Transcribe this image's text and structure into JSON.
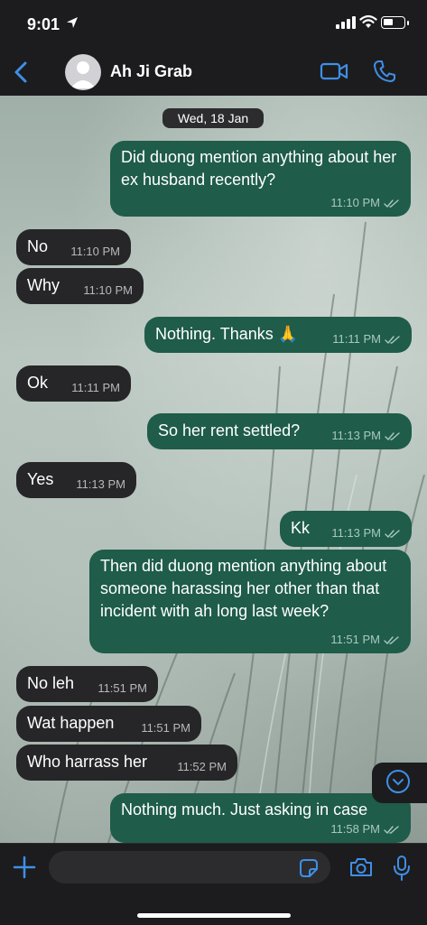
{
  "status": {
    "time": "9:01"
  },
  "header": {
    "contact_name": "Ah Ji Grab"
  },
  "date_separator": "Wed, 18 Jan",
  "messages": [
    {
      "dir": "out",
      "text": "Did duong mention anything about her ex husband recently?",
      "time": "11:10 PM"
    },
    {
      "dir": "in",
      "text": "No",
      "time": "11:10 PM"
    },
    {
      "dir": "in",
      "text": "Why",
      "time": "11:10 PM"
    },
    {
      "dir": "out",
      "text": "Nothing. Thanks 🙏",
      "time": "11:11 PM"
    },
    {
      "dir": "in",
      "text": "Ok",
      "time": "11:11 PM"
    },
    {
      "dir": "out",
      "text": "So her rent settled?",
      "time": "11:13 PM"
    },
    {
      "dir": "in",
      "text": "Yes",
      "time": "11:13 PM"
    },
    {
      "dir": "out",
      "text": "Kk",
      "time": "11:13 PM"
    },
    {
      "dir": "out",
      "text": "Then did duong mention anything about someone harassing her other than that incident with ah long last week?",
      "time": "11:51 PM"
    },
    {
      "dir": "in",
      "text": "No leh",
      "time": "11:51 PM"
    },
    {
      "dir": "in",
      "text": "Wat happen",
      "time": "11:51 PM"
    },
    {
      "dir": "in",
      "text": "Who harrass her",
      "time": "11:52 PM"
    },
    {
      "dir": "out",
      "text": "Nothing much. Just asking in case",
      "time": "11:58 PM"
    }
  ],
  "composer": {
    "placeholder": ""
  },
  "icons": {
    "back": "chevron-left-icon",
    "avatar": "person-icon",
    "video": "video-camera-icon",
    "call": "phone-icon",
    "plus": "plus-icon",
    "sticker": "sticker-icon",
    "camera": "camera-icon",
    "mic": "microphone-icon",
    "scroll": "chevron-down-icon",
    "read": "double-check-icon"
  },
  "colors": {
    "accent": "#3f8fe6",
    "outgoing_bubble": "#1f5c4a",
    "incoming_bubble": "#262628",
    "bar": "#1c1c1e"
  }
}
